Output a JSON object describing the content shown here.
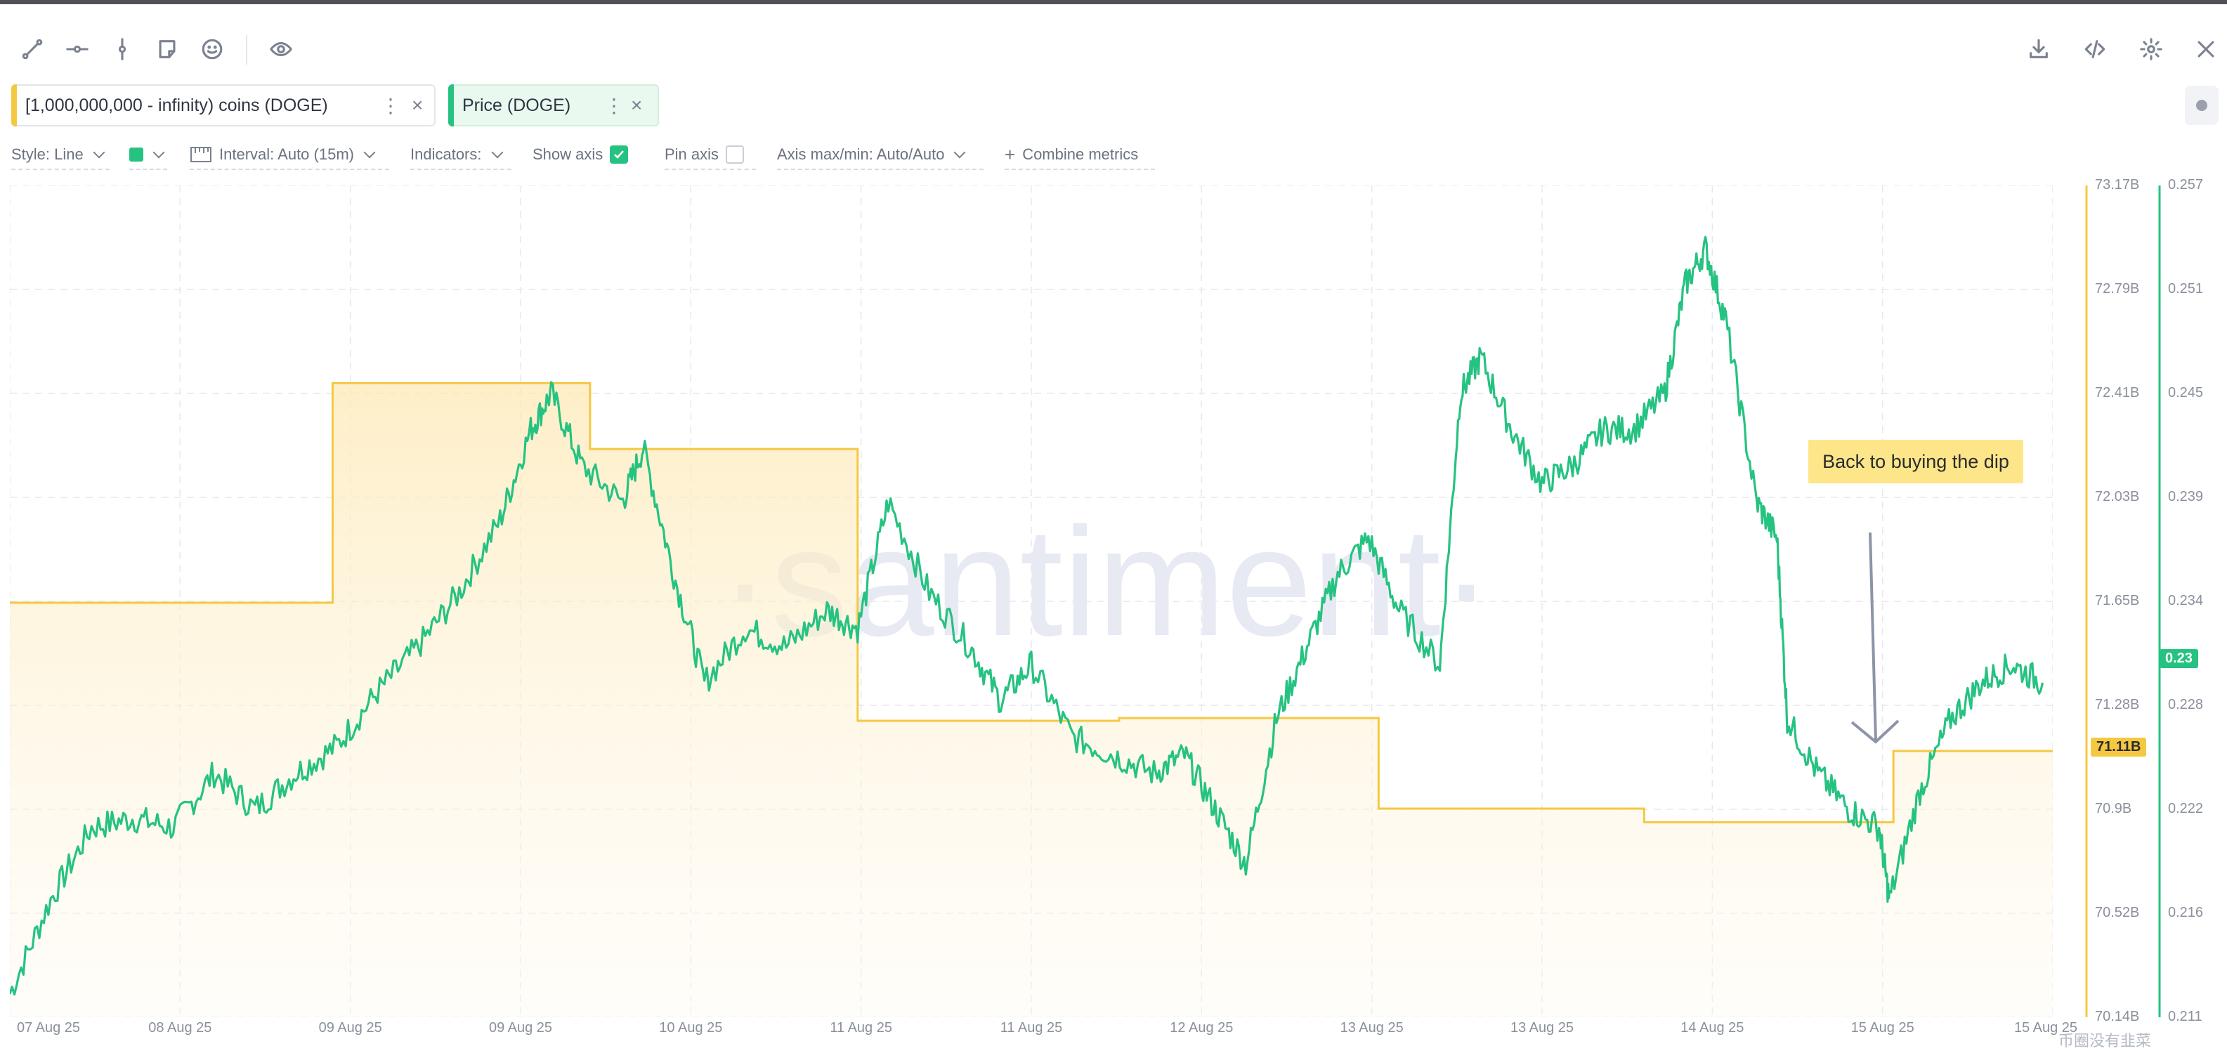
{
  "toolbar": {
    "left_tools": [
      "trend-line-icon",
      "horizontal-ray-icon",
      "vertical-line-icon",
      "note-icon",
      "emoji-icon",
      "eye-icon"
    ],
    "right_tools": [
      "download-icon",
      "embed-code-icon",
      "settings-icon",
      "close-icon"
    ]
  },
  "metrics": [
    {
      "label": "[1,000,000,000 - infinity) coins (DOGE)",
      "color": "#f5c842",
      "menu": "⋮",
      "remove": "×"
    },
    {
      "label": "Price (DOGE)",
      "color": "#26c281",
      "menu": "⋮",
      "remove": "×"
    }
  ],
  "options": {
    "style": "Style: Line",
    "color": "#26c281",
    "interval": "Interval: Auto (15m)",
    "indicators": "Indicators:",
    "show_axis": "Show axis",
    "show_axis_checked": true,
    "pin_axis": "Pin axis",
    "pin_axis_checked": false,
    "axis_maxmin": "Axis max/min: Auto/Auto",
    "combine": "Combine metrics",
    "combine_plus": "+"
  },
  "watermark": "·santiment·",
  "annotation": "Back to buying the dip",
  "corner_watermark": "币圈没有韭菜",
  "chart_data": {
    "type": "line",
    "x_ticks": [
      "07 Aug 25",
      "08 Aug 25",
      "09 Aug 25",
      "09 Aug 25",
      "10 Aug 25",
      "11 Aug 25",
      "11 Aug 25",
      "12 Aug 25",
      "13 Aug 25",
      "13 Aug 25",
      "14 Aug 25",
      "15 Aug 25",
      "15 Aug 25"
    ],
    "supply_axis": {
      "ticks": [
        "73.17B",
        "72.79B",
        "72.41B",
        "72.03B",
        "71.65B",
        "71.28B",
        "70.9B",
        "70.52B",
        "70.14B"
      ],
      "range": [
        70.14,
        73.17
      ],
      "current": "71.11B",
      "color": "#f5c842"
    },
    "price_axis": {
      "ticks": [
        "0.257",
        "0.251",
        "0.245",
        "0.239",
        "0.234",
        "0.228",
        "0.222",
        "0.216",
        "0.211"
      ],
      "range": [
        0.211,
        0.257
      ],
      "current": "0.23",
      "color": "#26c281"
    },
    "series": [
      {
        "name": "[1,000,000,000 - infinity) coins (DOGE)",
        "unit": "B",
        "steps": [
          [
            0,
            71.65
          ],
          [
            0.158,
            72.45
          ],
          [
            0.284,
            72.21
          ],
          [
            0.415,
            71.22
          ],
          [
            0.543,
            71.23
          ],
          [
            0.67,
            70.9
          ],
          [
            0.8,
            70.85
          ],
          [
            0.922,
            71.11
          ],
          [
            1.0,
            71.11
          ]
        ]
      },
      {
        "name": "Price (DOGE)",
        "points": [
          [
            0,
            0.2123
          ],
          [
            0.02,
            0.2175
          ],
          [
            0.04,
            0.2215
          ],
          [
            0.06,
            0.222
          ],
          [
            0.08,
            0.2215
          ],
          [
            0.1,
            0.2245
          ],
          [
            0.12,
            0.2225
          ],
          [
            0.14,
            0.2245
          ],
          [
            0.16,
            0.226
          ],
          [
            0.18,
            0.229
          ],
          [
            0.2,
            0.2315
          ],
          [
            0.22,
            0.2345
          ],
          [
            0.24,
            0.2385
          ],
          [
            0.255,
            0.2435
          ],
          [
            0.265,
            0.2455
          ],
          [
            0.28,
            0.2415
          ],
          [
            0.3,
            0.2395
          ],
          [
            0.31,
            0.2425
          ],
          [
            0.325,
            0.2355
          ],
          [
            0.34,
            0.2295
          ],
          [
            0.36,
            0.2325
          ],
          [
            0.38,
            0.2315
          ],
          [
            0.4,
            0.2335
          ],
          [
            0.415,
            0.2325
          ],
          [
            0.43,
            0.2395
          ],
          [
            0.45,
            0.2345
          ],
          [
            0.47,
            0.2315
          ],
          [
            0.485,
            0.2285
          ],
          [
            0.5,
            0.2305
          ],
          [
            0.52,
            0.2265
          ],
          [
            0.54,
            0.2255
          ],
          [
            0.56,
            0.2245
          ],
          [
            0.575,
            0.2255
          ],
          [
            0.59,
            0.2225
          ],
          [
            0.605,
            0.2195
          ],
          [
            0.62,
            0.2275
          ],
          [
            0.635,
            0.2315
          ],
          [
            0.65,
            0.2355
          ],
          [
            0.665,
            0.2375
          ],
          [
            0.68,
            0.2335
          ],
          [
            0.7,
            0.2305
          ],
          [
            0.71,
            0.2455
          ],
          [
            0.72,
            0.2475
          ],
          [
            0.735,
            0.2435
          ],
          [
            0.75,
            0.2405
          ],
          [
            0.765,
            0.2415
          ],
          [
            0.78,
            0.2435
          ],
          [
            0.795,
            0.2435
          ],
          [
            0.81,
            0.2455
          ],
          [
            0.82,
            0.2515
          ],
          [
            0.83,
            0.2535
          ],
          [
            0.84,
            0.2495
          ],
          [
            0.855,
            0.2395
          ],
          [
            0.865,
            0.2375
          ],
          [
            0.87,
            0.2275
          ],
          [
            0.885,
            0.2245
          ],
          [
            0.9,
            0.2225
          ],
          [
            0.915,
            0.2215
          ],
          [
            0.92,
            0.2175
          ],
          [
            0.935,
            0.2235
          ],
          [
            0.95,
            0.2275
          ],
          [
            0.965,
            0.2295
          ],
          [
            0.98,
            0.2305
          ],
          [
            0.995,
            0.2295
          ]
        ]
      }
    ],
    "grid": true
  }
}
